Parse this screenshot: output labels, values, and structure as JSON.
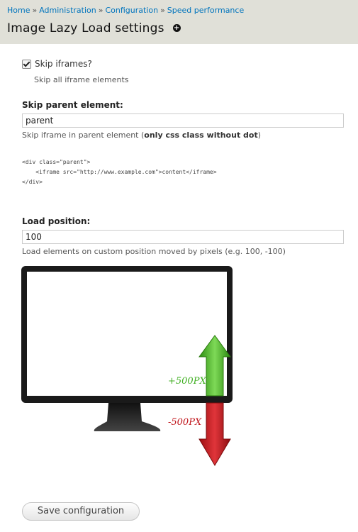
{
  "breadcrumb": {
    "items": [
      "Home",
      "Administration",
      "Configuration",
      "Speed performance"
    ],
    "separator": "»"
  },
  "header": {
    "title": "Image Lazy Load settings",
    "shortcut_icon": "plus-circle-icon"
  },
  "skip_iframes": {
    "label": "Skip iframes?",
    "checked": true,
    "description": "Skip all iframe elements"
  },
  "skip_parent": {
    "label": "Skip parent element:",
    "value": "parent",
    "description_prefix": "Skip iframe in parent element (",
    "description_bold": "only css class without dot",
    "description_suffix": ")",
    "code_lines": [
      "<div class=\"parent\">",
      "    <iframe src=\"http://www.example.com\">content</iframe>",
      "</div>"
    ]
  },
  "load_position": {
    "label": "Load position:",
    "value": "100",
    "description": "Load elements on custom position moved by pixels (e.g. 100, -100)",
    "diagram": {
      "up_label": "+500PX",
      "down_label": "-500PX",
      "up_color": "#3cae1e",
      "down_color": "#c0141a",
      "monitor_color": "#1a1a1a"
    }
  },
  "actions": {
    "save_label": "Save configuration"
  }
}
